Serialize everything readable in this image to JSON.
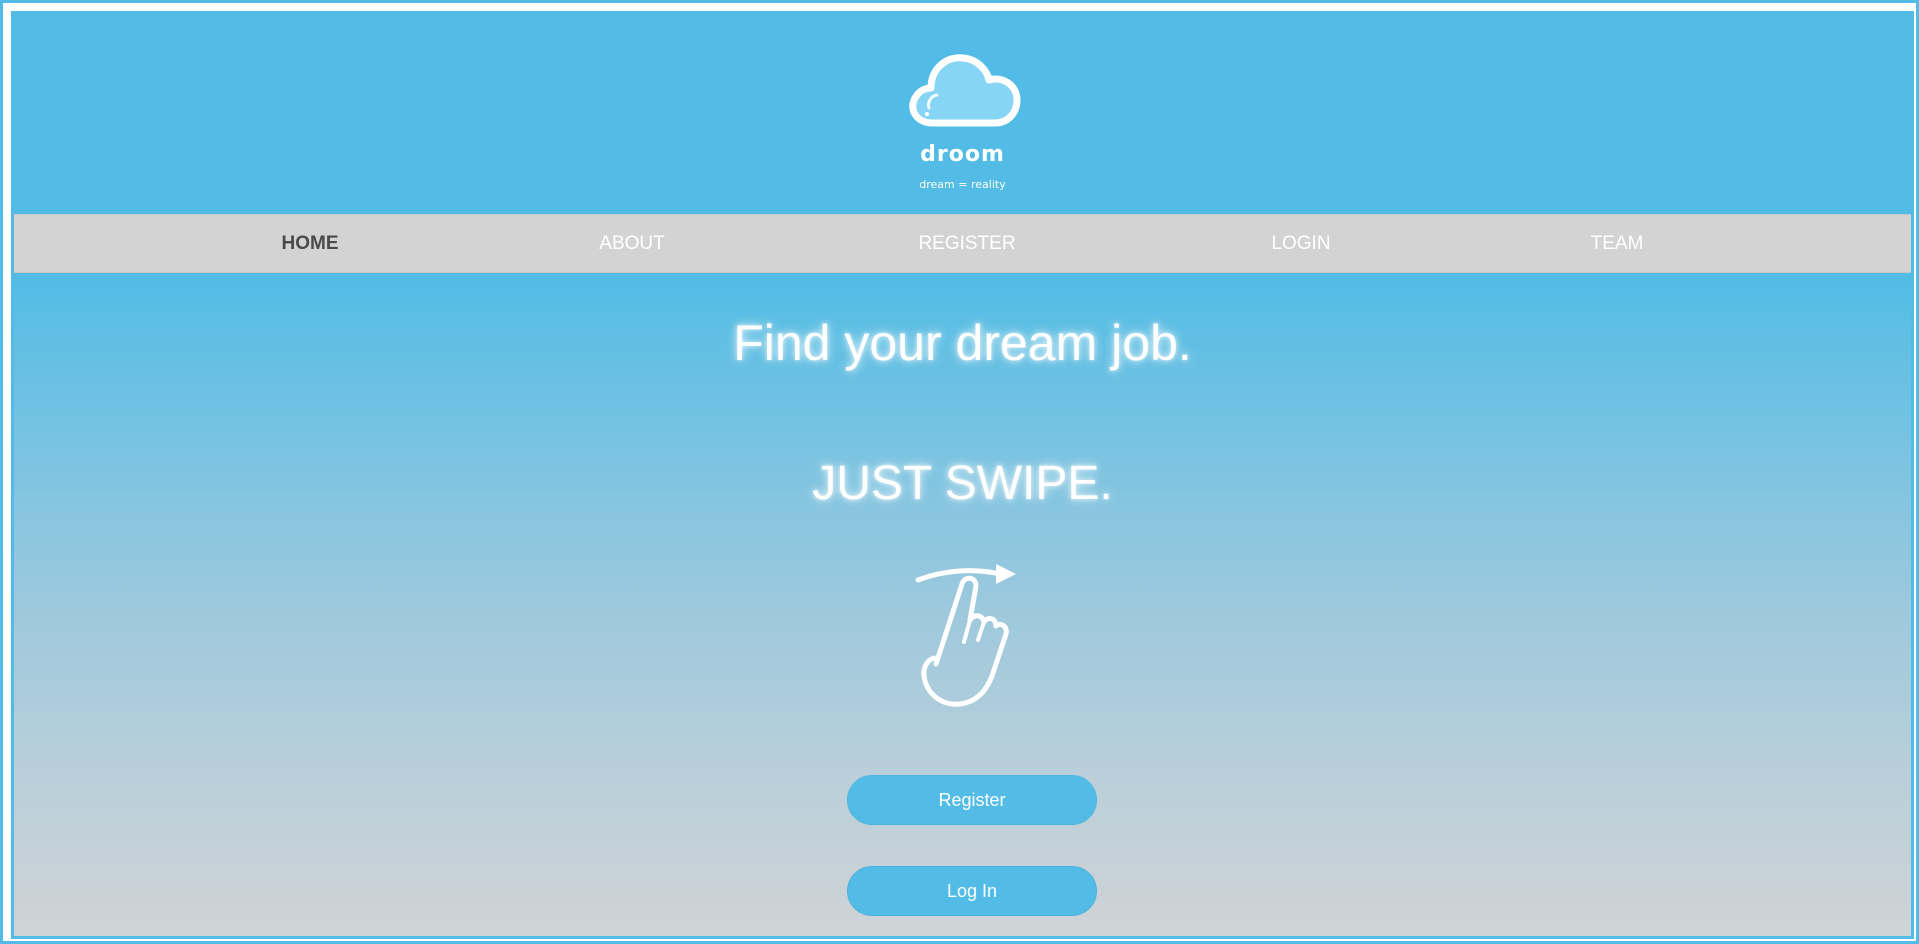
{
  "header": {
    "logo_icon": "cloud-icon",
    "brand": "droom",
    "tagline": "dream = reality"
  },
  "nav": {
    "items": [
      {
        "label": "HOME",
        "active": true
      },
      {
        "label": "ABOUT",
        "active": false
      },
      {
        "label": "REGISTER",
        "active": false
      },
      {
        "label": "LOGIN",
        "active": false
      },
      {
        "label": "TEAM",
        "active": false
      }
    ]
  },
  "hero": {
    "headline": "Find your dream job.",
    "subheadline": "JUST SWIPE.",
    "gesture_icon": "swipe-hand-icon"
  },
  "actions": {
    "register_label": "Register",
    "login_label": "Log In"
  },
  "colors": {
    "accent": "#52bce6",
    "nav_background": "#d3d3d3",
    "active_nav_text": "#4a4a4a",
    "gradient_bottom": "#cfd3d6"
  }
}
